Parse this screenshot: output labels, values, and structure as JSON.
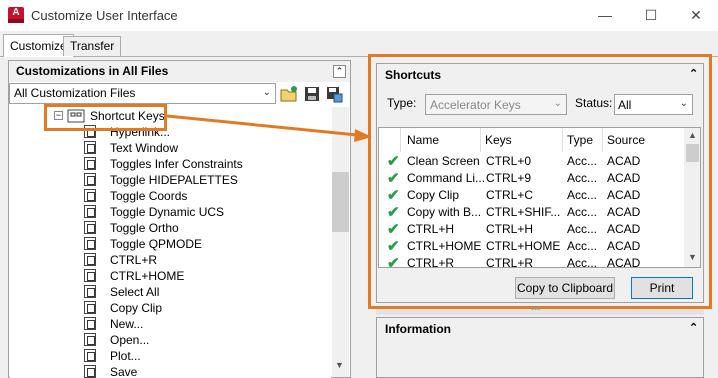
{
  "window": {
    "title": "Customize User Interface",
    "app_icon_letter": "A",
    "minimize": "—",
    "maximize": "☐",
    "close": "✕"
  },
  "tabs": [
    {
      "label": "Customize"
    },
    {
      "label": "Transfer"
    }
  ],
  "left_panel": {
    "header": "Customizations in All Files",
    "file_select": "All Customization Files",
    "tree_root": "Shortcut Keys",
    "tree_items": [
      "Hyperlink...",
      "Text Window",
      "Toggles Infer Constraints",
      "Toggle HIDEPALETTES",
      "Toggle Coords",
      "Toggle Dynamic UCS",
      "Toggle Ortho",
      "Toggle QPMODE",
      "CTRL+R",
      "CTRL+HOME",
      "Select All",
      "Copy Clip",
      "New...",
      "Open...",
      "Plot...",
      "Save"
    ]
  },
  "shortcuts_panel": {
    "header": "Shortcuts",
    "type_label": "Type:",
    "type_value": "Accelerator Keys",
    "status_label": "Status:",
    "status_value": "All",
    "columns": [
      "Name",
      "Keys",
      "Type",
      "Source"
    ],
    "rows": [
      {
        "name": "Clean Screen",
        "keys": "CTRL+0",
        "type": "Acc...",
        "source": "ACAD"
      },
      {
        "name": "Command Li...",
        "keys": "CTRL+9",
        "type": "Acc...",
        "source": "ACAD"
      },
      {
        "name": "Copy Clip",
        "keys": "CTRL+C",
        "type": "Acc...",
        "source": "ACAD"
      },
      {
        "name": "Copy with B...",
        "keys": "CTRL+SHIF...",
        "type": "Acc...",
        "source": "ACAD"
      },
      {
        "name": "CTRL+H",
        "keys": "CTRL+H",
        "type": "Acc...",
        "source": "ACAD"
      },
      {
        "name": "CTRL+HOME",
        "keys": "CTRL+HOME",
        "type": "Acc...",
        "source": "ACAD"
      },
      {
        "name": "CTRL+R",
        "keys": "CTRL+R",
        "type": "Acc...",
        "source": "ACAD"
      }
    ],
    "copy_button": "Copy to Clipboard",
    "print_button": "Print"
  },
  "information_panel": {
    "header": "Information"
  },
  "colors": {
    "callout": "#e07b24",
    "check": "#2a9d4a",
    "accent": "#0078d7"
  }
}
